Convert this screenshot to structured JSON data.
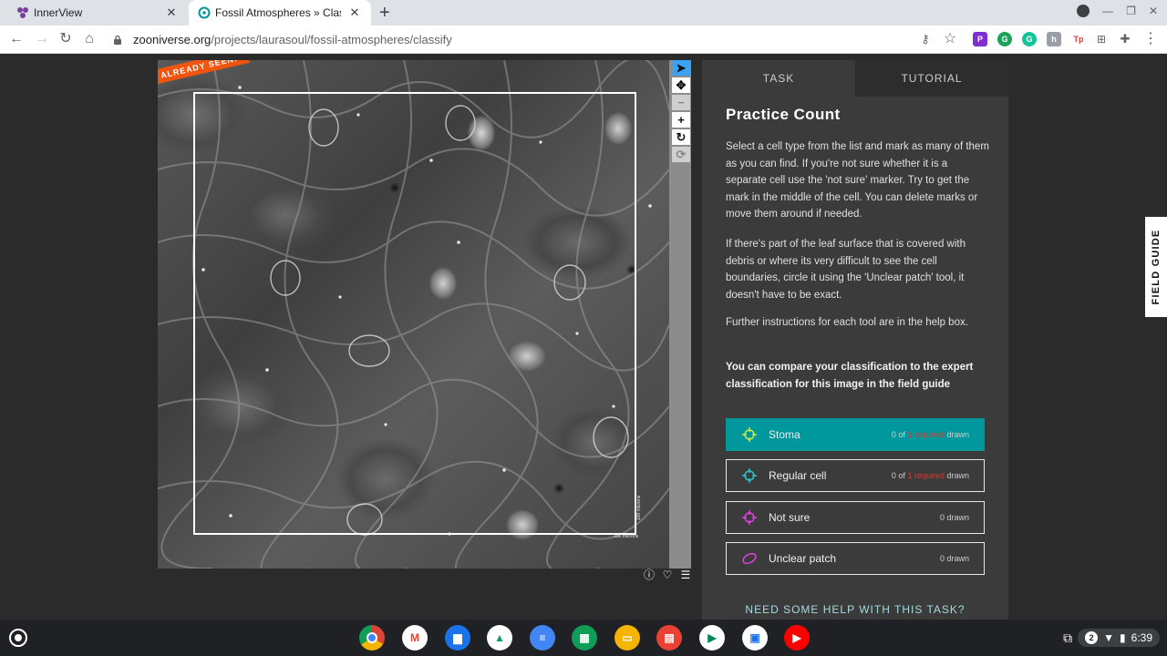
{
  "browser": {
    "tabs": [
      {
        "title": "InnerView",
        "active": false
      },
      {
        "title": "Fossil Atmospheres » Classify — Zooniverse",
        "active": true
      }
    ],
    "new_tab_label": "+",
    "url_host": "zooniverse.org",
    "url_path": "/projects/laurasoul/fossil-atmospheres/classify"
  },
  "subject": {
    "badge": "ALREADY SEEN!",
    "scale_bar_h": "100 microns",
    "scale_bar_v": "100 microns"
  },
  "task_panel": {
    "tabs": [
      "TASK",
      "TUTORIAL"
    ],
    "title": "Practice Count",
    "paragraphs": [
      "Select a cell type from the list and mark as many of them as you can find. If you're not sure whether it is a separate cell use the 'not sure' marker. Try to get the mark in the middle of the cell. You can delete marks or move them around if needed.",
      "If there's part of the leaf surface that is covered with debris or where its very difficult to see the cell boundaries, circle it using the 'Unclear patch' tool, it doesn't have to be exact.",
      "Further instructions for each tool are in the help box.",
      "You can compare your classification to the expert classification for this image in the field guide"
    ],
    "tools": [
      {
        "label": "Stoma",
        "count_prefix": "0 of",
        "count_required": "1 required",
        "count_suffix": "drawn",
        "color": "#c7e84a",
        "selected": true
      },
      {
        "label": "Regular cell",
        "count_prefix": "0 of",
        "count_required": "1 required",
        "count_suffix": "drawn",
        "color": "#2ec2c9",
        "selected": false
      },
      {
        "label": "Not sure",
        "count_prefix": "",
        "count_required": "",
        "count_suffix": "0 drawn",
        "color": "#e040e0",
        "selected": false
      },
      {
        "label": "Unclear patch",
        "count_prefix": "",
        "count_required": "",
        "count_suffix": "0 drawn",
        "color": "#e040e0",
        "selected": false
      }
    ],
    "help_link": "NEED SOME HELP WITH THIS TASK?"
  },
  "field_guide": "FIELD GUIDE",
  "shelf": {
    "notification_count": "2",
    "time": "6:39"
  },
  "colors": {
    "accent_teal": "#00979d",
    "badge_orange": "#f0540f",
    "panel_bg": "#3b3b3b",
    "required_red": "#e5352b"
  }
}
